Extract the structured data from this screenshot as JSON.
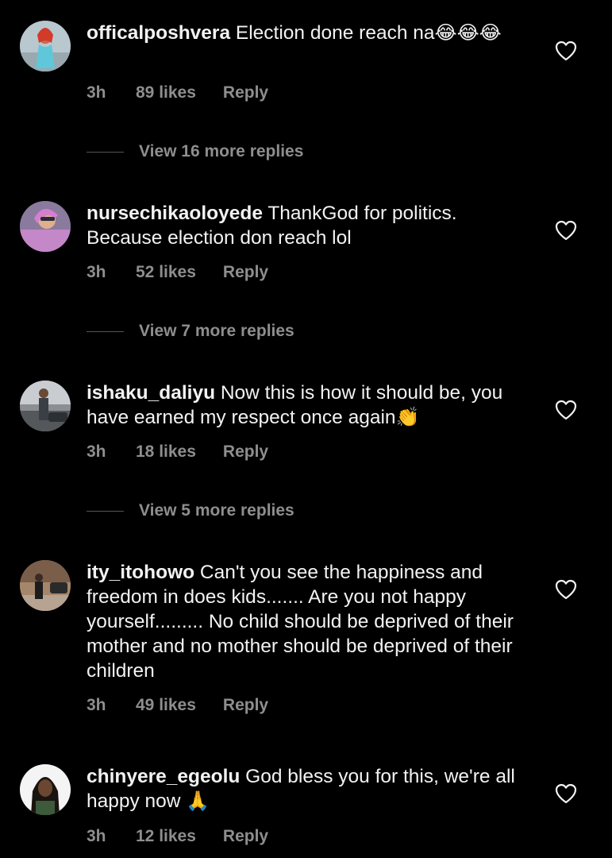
{
  "comments": [
    {
      "username": "officalposhvera",
      "text": " Election done reach na",
      "emojis": "😂😂😂",
      "time": "3h",
      "likes": "89 likes",
      "reply": "Reply",
      "view_replies": "View 16 more replies"
    },
    {
      "username": "nursechikaoloyede",
      "text": " ThankGod for politics. Because election don reach lol",
      "time": "3h",
      "likes": "52 likes",
      "reply": "Reply",
      "view_replies": "View 7 more replies"
    },
    {
      "username": "ishaku_daliyu",
      "text": " Now this is how it should be, you have earned my respect once again",
      "emojis": "👏",
      "time": "3h",
      "likes": "18 likes",
      "reply": "Reply",
      "view_replies": "View 5 more replies"
    },
    {
      "username": "ity_itohowo",
      "text": " Can't you see the happiness and freedom in does kids....... Are you not happy yourself......... No child should be deprived of their mother and no mother should be deprived of their children",
      "time": "3h",
      "likes": "49 likes",
      "reply": "Reply"
    },
    {
      "username": "chinyere_egeolu",
      "text": " God bless you for this, we're all happy now ",
      "emojis": "🙏",
      "time": "3h",
      "likes": "12 likes",
      "reply": "Reply"
    }
  ],
  "icons": {
    "like": "heart-outline-icon"
  },
  "colors": {
    "background": "#000000",
    "text": "#f2f2f2",
    "muted": "#8e8e8e"
  }
}
